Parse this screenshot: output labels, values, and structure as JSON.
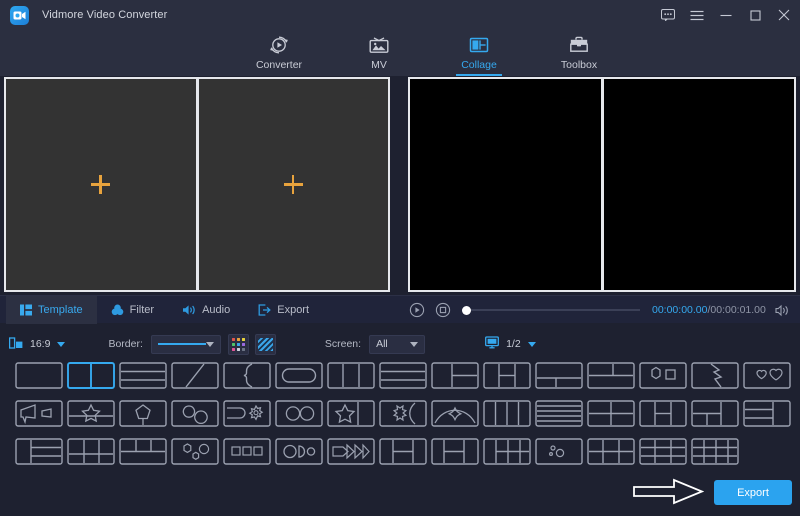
{
  "window": {
    "app_title": "Vidmore Video Converter",
    "controls": [
      {
        "name": "feedback-icon",
        "label": "feedback"
      },
      {
        "name": "menu-icon",
        "label": "menu"
      },
      {
        "name": "minimize-icon",
        "label": "minimize"
      },
      {
        "name": "maximize-icon",
        "label": "maximize"
      },
      {
        "name": "close-icon",
        "label": "close"
      }
    ]
  },
  "nav": {
    "tabs": [
      {
        "label": "Converter",
        "icon": "converter-icon",
        "active": false
      },
      {
        "label": "MV",
        "icon": "mv-icon",
        "active": false
      },
      {
        "label": "Collage",
        "icon": "collage-icon",
        "active": true
      },
      {
        "label": "Toolbox",
        "icon": "toolbox-icon",
        "active": false
      }
    ],
    "active_index": 2,
    "accent_color": "#35a9ef"
  },
  "editor": {
    "cells": [
      {
        "name": "add-media-cell-1",
        "icon": "plus-icon"
      },
      {
        "name": "add-media-cell-2",
        "icon": "plus-icon"
      }
    ],
    "plus_color": "#e8a33d",
    "border_color": "#e6e8ec",
    "cell_bg": "#333333"
  },
  "preview": {
    "cells": [
      "preview-cell-1",
      "preview-cell-2"
    ],
    "bg": "#000000"
  },
  "edit_tabs": [
    {
      "label": "Template",
      "icon": "template-icon",
      "active": true
    },
    {
      "label": "Filter",
      "icon": "filter-icon",
      "active": false
    },
    {
      "label": "Audio",
      "icon": "audio-icon",
      "active": false
    },
    {
      "label": "Export",
      "icon": "export-icon",
      "active": false
    }
  ],
  "player": {
    "play_icon": "play-icon",
    "stop_icon": "stop-icon",
    "volume_icon": "volume-icon",
    "current_time": "00:00:00.00",
    "separator": "/",
    "total_time": "00:00:01.00",
    "progress_percent": 0
  },
  "options": {
    "ratio_icon": "aspect-ratio-icon",
    "ratio_value": "16:9",
    "border_label": "Border:",
    "border_style": "solid-line",
    "border_color_icon": "color-palette-icon",
    "border_pattern_icon": "stripe-pattern-icon",
    "screen_label": "Screen:",
    "screen_value": "All",
    "monitor_icon": "monitor-icon",
    "page_value": "1/2"
  },
  "templates": {
    "selected_index": 1,
    "items": [
      {
        "name": "template-1-single",
        "layout": "single"
      },
      {
        "name": "template-2-two-vertical",
        "layout": "two-vertical"
      },
      {
        "name": "template-3-three-horizontal",
        "layout": "three-horizontal"
      },
      {
        "name": "template-4-diagonal",
        "layout": "diagonal"
      },
      {
        "name": "template-5-arc-split",
        "layout": "arc-split"
      },
      {
        "name": "template-6-rounded-inset",
        "layout": "rounded-inset"
      },
      {
        "name": "template-7-three-columns",
        "layout": "three-columns"
      },
      {
        "name": "template-8-three-rows",
        "layout": "three-rows"
      },
      {
        "name": "template-9-left-two-right",
        "layout": "left-two-right"
      },
      {
        "name": "template-10-left-right-split",
        "layout": "left-right-split"
      },
      {
        "name": "template-11-bottom-two",
        "layout": "bottom-two"
      },
      {
        "name": "template-12-top-two",
        "layout": "top-two"
      },
      {
        "name": "template-13-hex-square",
        "layout": "hex-square"
      },
      {
        "name": "template-14-zigzag",
        "layout": "zigzag"
      },
      {
        "name": "template-15-two-hearts",
        "layout": "two-hearts"
      },
      {
        "name": "template-16-megaphone",
        "layout": "megaphone"
      },
      {
        "name": "template-17-star-band",
        "layout": "star-band"
      },
      {
        "name": "template-18-pentagon",
        "layout": "pentagon"
      },
      {
        "name": "template-19-two-circles",
        "layout": "two-circles"
      },
      {
        "name": "template-20-gear",
        "layout": "gear"
      },
      {
        "name": "template-21-double-circle",
        "layout": "double-circle"
      },
      {
        "name": "template-22-star-split",
        "layout": "star-split"
      },
      {
        "name": "template-23-burst",
        "layout": "burst"
      },
      {
        "name": "template-24-arc-diamond",
        "layout": "arc-diamond"
      },
      {
        "name": "template-25-four-columns",
        "layout": "four-columns"
      },
      {
        "name": "template-26-five-rows",
        "layout": "five-rows"
      },
      {
        "name": "template-27-quad",
        "layout": "quad"
      },
      {
        "name": "template-28-quad-uneven",
        "layout": "quad-uneven"
      },
      {
        "name": "template-29-tri-offset",
        "layout": "tri-offset"
      },
      {
        "name": "template-30-two-rows-right",
        "layout": "two-rows-right"
      },
      {
        "name": "template-31-left-stack",
        "layout": "left-stack"
      },
      {
        "name": "template-32-three-bottom",
        "layout": "three-bottom"
      },
      {
        "name": "template-33-two-top-wide",
        "layout": "two-top-wide"
      },
      {
        "name": "template-34-three-shapes",
        "layout": "three-shapes"
      },
      {
        "name": "template-35-three-squares",
        "layout": "three-squares"
      },
      {
        "name": "template-36-circle-row",
        "layout": "circle-row"
      },
      {
        "name": "template-37-arrows",
        "layout": "arrows"
      },
      {
        "name": "template-38-h-split",
        "layout": "h-split"
      },
      {
        "name": "template-39-five-mixed",
        "layout": "five-mixed"
      },
      {
        "name": "template-40-six-grid",
        "layout": "six-grid"
      },
      {
        "name": "template-41-bubbles",
        "layout": "bubbles"
      },
      {
        "name": "template-42-six-even",
        "layout": "six-even"
      },
      {
        "name": "template-43-nine-grid",
        "layout": "nine-grid"
      },
      {
        "name": "template-44-twelve-grid",
        "layout": "twelve-grid"
      }
    ]
  },
  "footer": {
    "export_label": "Export",
    "export_color": "#2ba3ef",
    "arrow_icon": "big-arrow-pointer"
  }
}
